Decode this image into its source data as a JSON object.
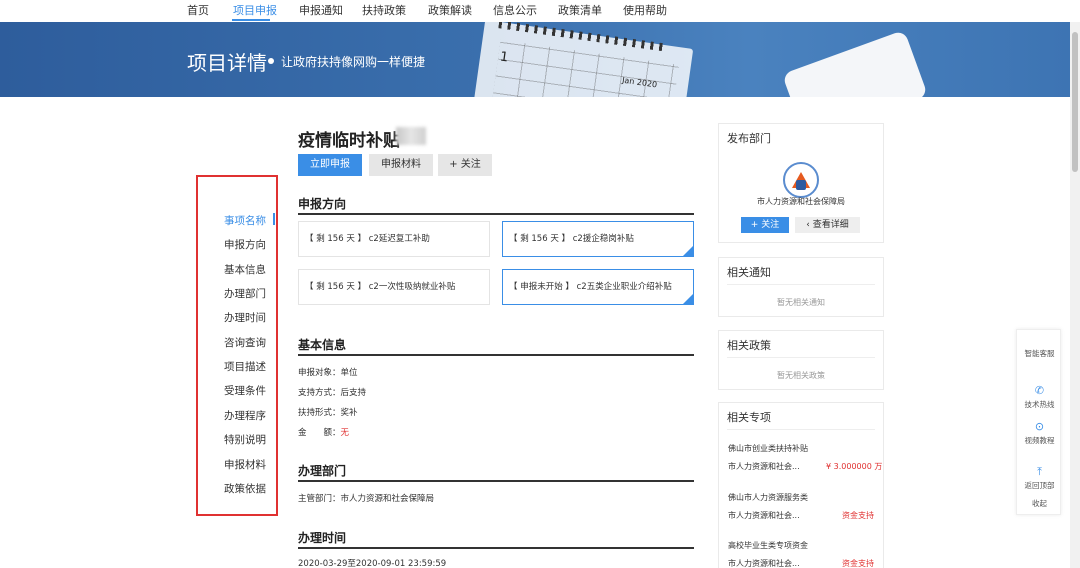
{
  "nav": {
    "items": [
      "首页",
      "项目申报",
      "申报通知",
      "扶持政策",
      "政策解读",
      "信息公示",
      "政策清单",
      "使用帮助"
    ],
    "active": "项目申报"
  },
  "banner": {
    "title": "项目详情",
    "slogan": "让政府扶持像网购一样便捷",
    "calendar_number": "1",
    "calendar_year": "Jan 2020"
  },
  "side_nav": {
    "items": [
      "事项名称",
      "申报方向",
      "基本信息",
      "办理部门",
      "办理时间",
      "咨询查询",
      "项目描述",
      "受理条件",
      "办理程序",
      "特别说明",
      "申报材料",
      "政策依据"
    ],
    "active": "事项名称"
  },
  "project": {
    "title": "疫情临时补贴",
    "buttons": {
      "apply": "立即申报",
      "materials": "申报材料",
      "follow": "+ 关注"
    }
  },
  "directions": {
    "title": "申报方向",
    "cards": [
      {
        "status": "【 剩 156 天 】",
        "name": "c2延迟复工补助",
        "selected": false
      },
      {
        "status": "【 剩 156 天 】",
        "name": "c2援企稳岗补贴",
        "selected": true
      },
      {
        "status": "【 剩 156 天 】",
        "name": "c2一次性吸纳就业补贴",
        "selected": false
      },
      {
        "status": "【 申报未开始 】",
        "name": "c2五类企业职业介绍补贴",
        "selected": true
      }
    ]
  },
  "basic_info": {
    "title": "基本信息",
    "rows": [
      {
        "label": "申报对象：",
        "value": "单位"
      },
      {
        "label": "支持方式：",
        "value": "后支持"
      },
      {
        "label": "扶持形式：",
        "value": "奖补"
      },
      {
        "label": "金　　额：",
        "value": "无"
      }
    ]
  },
  "department": {
    "title": "办理部门",
    "text": "主管部门：市人力资源和社会保障局"
  },
  "handling_time": {
    "title": "办理时间",
    "text": "2020-03-29至2020-09-01 23:59:59"
  },
  "publisher": {
    "title": "发布部门",
    "org": "市人力资源和社会保障局",
    "follow_label": "+ 关注",
    "detail_label": "查看详细"
  },
  "notices": {
    "title": "相关通知",
    "empty": "暂无相关通知"
  },
  "policies": {
    "title": "相关政策",
    "empty": "暂无相关政策"
  },
  "topics": {
    "title": "相关专项",
    "items": [
      {
        "name": "佛山市创业类扶持补贴",
        "org": "市人力资源和社会...",
        "value": "¥ 3.000000 万"
      },
      {
        "name": "佛山市人力资源服务类",
        "org": "市人力资源和社会...",
        "value": "资金支持"
      },
      {
        "name": "高校毕业生类专项资金",
        "org": "市人力资源和社会...",
        "value": "资金支持"
      }
    ]
  },
  "float_tools": [
    "智能客服",
    "技术热线",
    "视频教程",
    "返回顶部",
    "收起"
  ],
  "colors": {
    "primary": "#3a8ee6",
    "highlight_border": "#e03131",
    "banner": "#2e5d9c"
  }
}
